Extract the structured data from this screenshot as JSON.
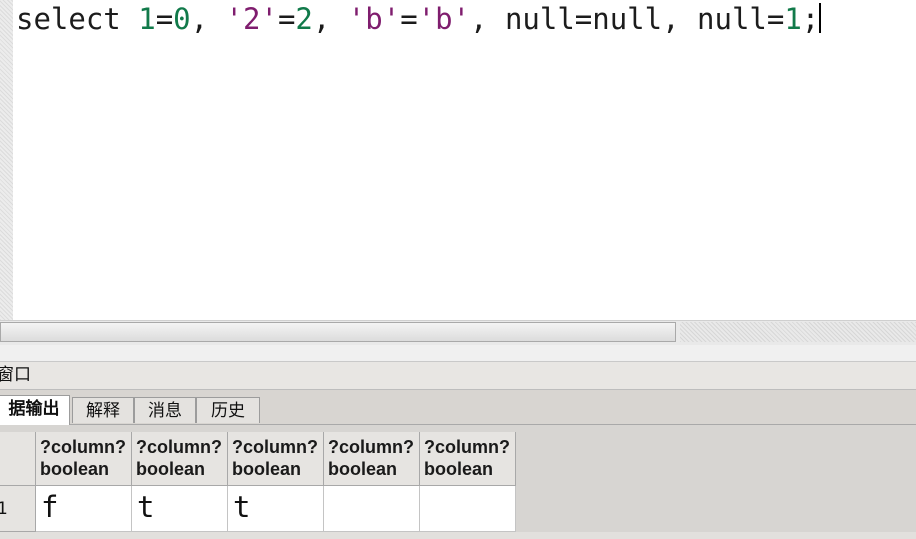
{
  "editor": {
    "tokens": [
      {
        "text": "select ",
        "kind": "kw"
      },
      {
        "text": "1",
        "kind": "num"
      },
      {
        "text": "=",
        "kind": "op"
      },
      {
        "text": "0",
        "kind": "num"
      },
      {
        "text": ", ",
        "kind": "op"
      },
      {
        "text": "'2'",
        "kind": "str"
      },
      {
        "text": "=",
        "kind": "op"
      },
      {
        "text": "2",
        "kind": "num"
      },
      {
        "text": ", ",
        "kind": "op"
      },
      {
        "text": "'b'",
        "kind": "str"
      },
      {
        "text": "=",
        "kind": "op"
      },
      {
        "text": "'b'",
        "kind": "str"
      },
      {
        "text": ", null=null, null=",
        "kind": "kw"
      },
      {
        "text": "1",
        "kind": "num"
      },
      {
        "text": ";",
        "kind": "op"
      }
    ]
  },
  "panel": {
    "title": "窗口",
    "tabs": [
      {
        "label": "据输出",
        "active": true
      },
      {
        "label": "解释",
        "active": false
      },
      {
        "label": "消息",
        "active": false
      },
      {
        "label": "历史",
        "active": false
      }
    ]
  },
  "grid": {
    "columns": [
      {
        "name": "?column?",
        "type": "boolean"
      },
      {
        "name": "?column?",
        "type": "boolean"
      },
      {
        "name": "?column?",
        "type": "boolean"
      },
      {
        "name": "?column?",
        "type": "boolean"
      },
      {
        "name": "?column?",
        "type": "boolean"
      }
    ],
    "rows": [
      {
        "num": "1",
        "cells": [
          "f",
          "t",
          "t",
          "",
          ""
        ]
      }
    ]
  }
}
